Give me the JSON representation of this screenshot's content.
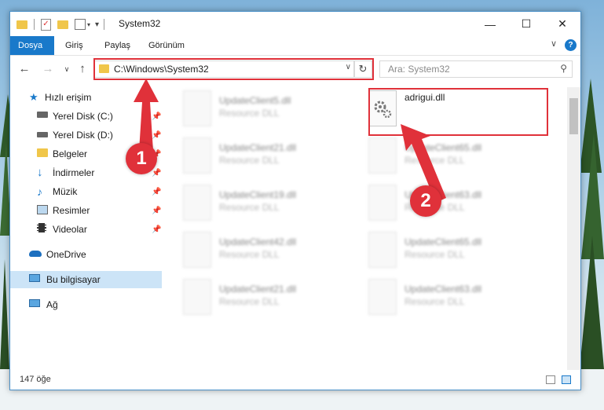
{
  "window": {
    "title": "System32"
  },
  "ribbon": {
    "tabs": [
      "Dosya",
      "Giriş",
      "Paylaş",
      "Görünüm"
    ]
  },
  "address": {
    "path": "C:\\Windows\\System32"
  },
  "search": {
    "placeholder": "Ara: System32"
  },
  "sidebar": {
    "items": [
      {
        "label": "Hızlı erişim",
        "icon": "star-icon"
      },
      {
        "label": "Yerel Disk (C:)",
        "icon": "drive-icon"
      },
      {
        "label": "Yerel Disk (D:)",
        "icon": "drive-icon"
      },
      {
        "label": "Belgeler",
        "icon": "folder-icon"
      },
      {
        "label": "İndirmeler",
        "icon": "download-icon"
      },
      {
        "label": "Müzik",
        "icon": "music-icon"
      },
      {
        "label": "Resimler",
        "icon": "pictures-icon"
      },
      {
        "label": "Videolar",
        "icon": "video-icon"
      },
      {
        "label": "OneDrive",
        "icon": "cloud-icon"
      },
      {
        "label": "Bu bilgisayar",
        "icon": "computer-icon"
      },
      {
        "label": "Ağ",
        "icon": "network-icon"
      }
    ]
  },
  "files": [
    {
      "name": "UpdateClient5.dll",
      "type": "Resource DLL"
    },
    {
      "name": "adrigui.dll",
      "type": ""
    },
    {
      "name": "UpdateClient21.dll",
      "type": "Resource DLL"
    },
    {
      "name": "UpdateClient65.dll",
      "type": "Resource DLL"
    },
    {
      "name": "UpdateClient19.dll",
      "type": "Resource DLL"
    },
    {
      "name": "UpdateClient63.dll",
      "type": "Resource DLL"
    },
    {
      "name": "UpdateClient42.dll",
      "type": "Resource DLL"
    },
    {
      "name": "UpdateClient65.dll",
      "type": "Resource DLL"
    },
    {
      "name": "UpdateClient21.dll",
      "type": "Resource DLL"
    },
    {
      "name": "UpdateClient63.dll",
      "type": "Resource DLL"
    }
  ],
  "status": {
    "count": "147 öğe"
  },
  "annotations": {
    "badge1": "1",
    "badge2": "2",
    "accent": "#e0313a"
  }
}
